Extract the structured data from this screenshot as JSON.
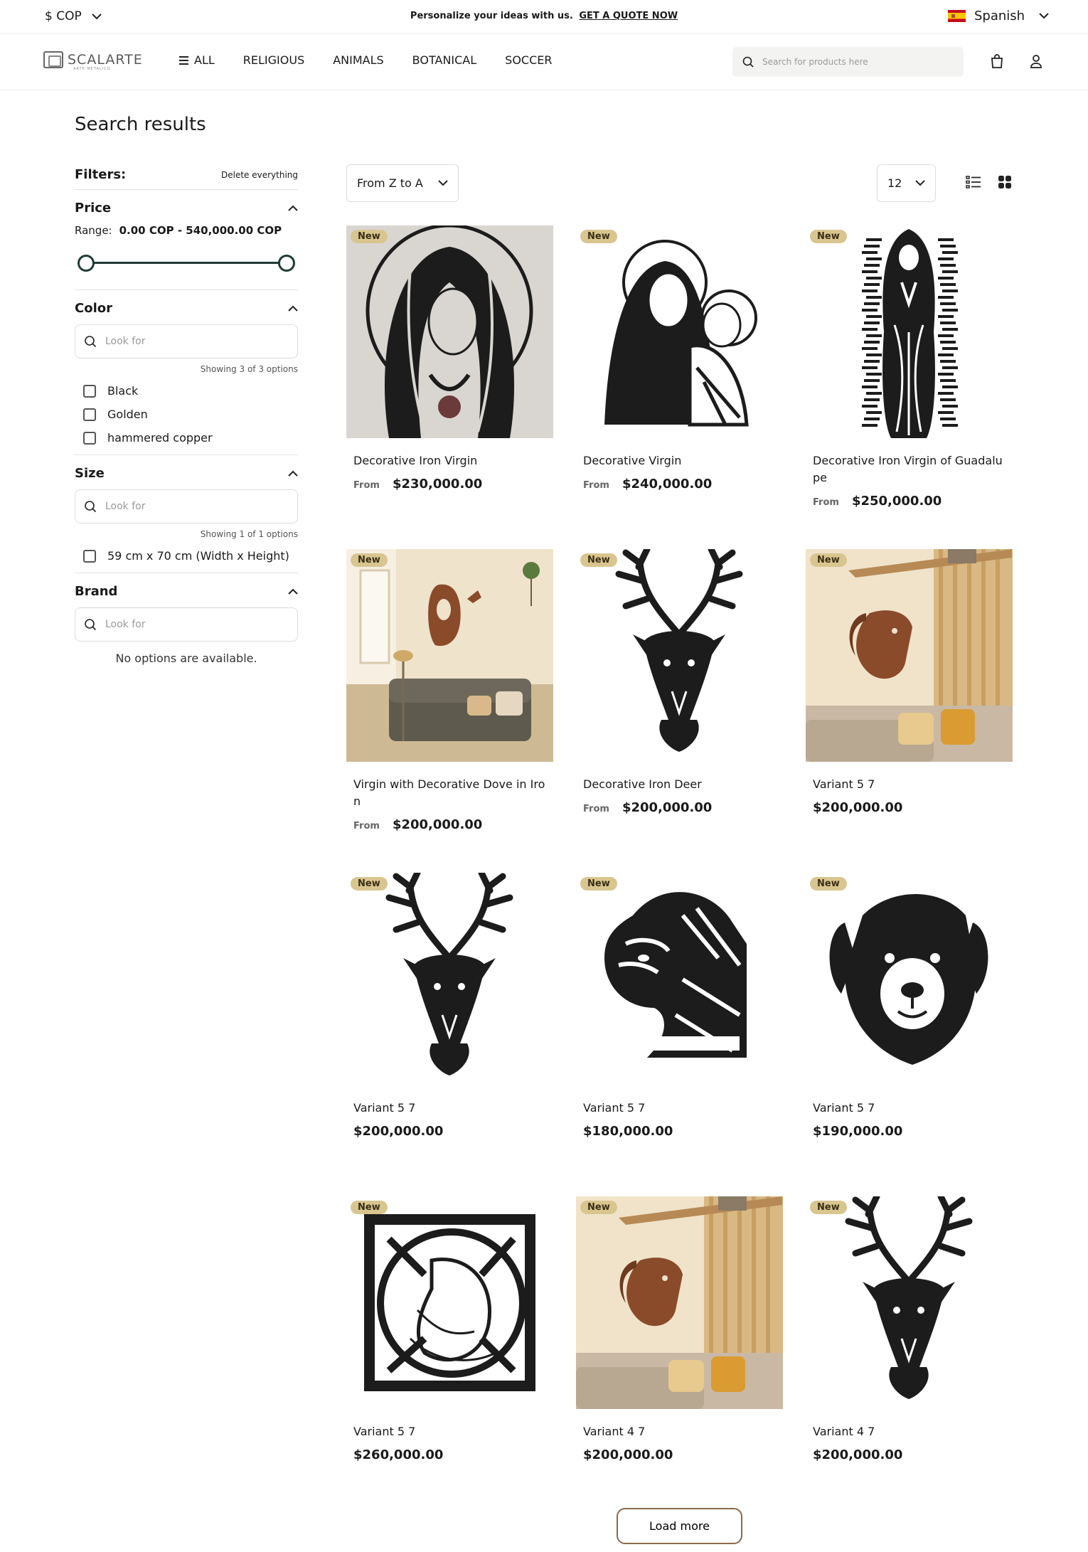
{
  "topbar": {
    "currency": "$ COP",
    "promo_text": "Personalize your ideas with us.",
    "promo_cta": "GET A QUOTE NOW",
    "language": "Spanish"
  },
  "header": {
    "logo_text": "SCALARTE",
    "logo_tagline": "ARTE METALICO",
    "nav": [
      "ALL",
      "RELIGIOUS",
      "ANIMALS",
      "BOTANICAL",
      "SOCCER"
    ],
    "search_placeholder": "Search for products here"
  },
  "page": {
    "title": "Search results"
  },
  "filters": {
    "label": "Filters:",
    "clear": "Delete everything",
    "price": {
      "title": "Price",
      "range_label": "Range:",
      "range_value": "0.00 COP - 540,000.00 COP"
    },
    "color": {
      "title": "Color",
      "placeholder": "Look for",
      "showing": "Showing 3 of 3 options",
      "options": [
        "Black",
        "Golden",
        "hammered copper"
      ]
    },
    "size": {
      "title": "Size",
      "placeholder": "Look for",
      "showing": "Showing 1 of 1 options",
      "options": [
        "59 cm x 70 cm (Width x Height)"
      ]
    },
    "brand": {
      "title": "Brand",
      "placeholder": "Look for",
      "empty": "No options are available."
    }
  },
  "toolbar": {
    "sort": "From Z to A",
    "per_page": "12"
  },
  "products": [
    {
      "badge": "New",
      "name": "Decorative Iron Virgin",
      "from": "From",
      "price": "$230,000.00",
      "art": "virgin-veil-art"
    },
    {
      "badge": "New",
      "name": "Decorative Virgin",
      "from": "From",
      "price": "$240,000.00",
      "art": "virgin-child-art"
    },
    {
      "badge": "New",
      "name": "Decorative Iron Virgin of Guadalupe",
      "from": "From",
      "price": "$250,000.00",
      "art": "guadalupe-art"
    },
    {
      "badge": "New",
      "name": "Virgin with Decorative Dove in Iron",
      "from": "From",
      "price": "$200,000.00",
      "art": "virgin-dove-room-photo"
    },
    {
      "badge": "New",
      "name": "Decorative Iron Deer",
      "from": "From",
      "price": "$200,000.00",
      "art": "deer-art"
    },
    {
      "badge": "New",
      "name": "Variant 5 7",
      "from": "",
      "price": "$200,000.00",
      "art": "horse-room-photo"
    },
    {
      "badge": "New",
      "name": "Variant 5 7",
      "from": "",
      "price": "$200,000.00",
      "art": "deer-art"
    },
    {
      "badge": "New",
      "name": "Variant 5 7",
      "from": "",
      "price": "$180,000.00",
      "art": "tiger-art"
    },
    {
      "badge": "New",
      "name": "Variant 5 7",
      "from": "",
      "price": "$190,000.00",
      "art": "dog-art"
    },
    {
      "badge": "New",
      "name": "Variant 5 7",
      "from": "",
      "price": "$260,000.00",
      "art": "horse-square-art"
    },
    {
      "badge": "New",
      "name": "Variant 4 7",
      "from": "",
      "price": "$200,000.00",
      "art": "horse-room-photo"
    },
    {
      "badge": "New",
      "name": "Variant 4 7",
      "from": "",
      "price": "$200,000.00",
      "art": "deer-art"
    }
  ],
  "load_more": "Load more",
  "colors": {
    "accent_dark_green": "#1f3b35",
    "badge_gold": "#d9c58f",
    "button_border": "#8b6a4a"
  }
}
